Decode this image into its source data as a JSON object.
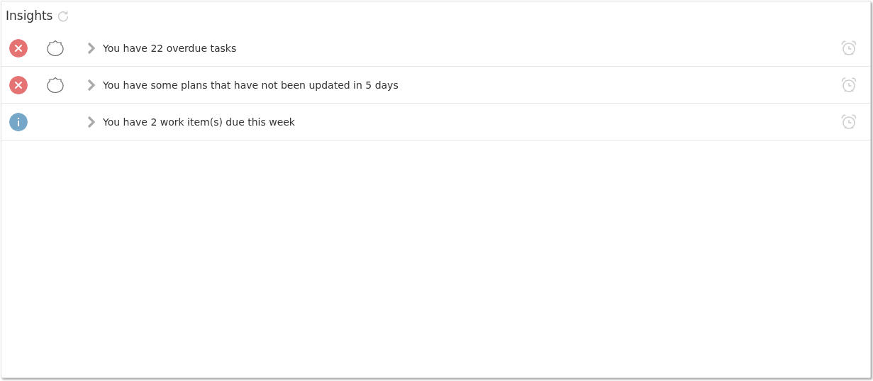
{
  "panel": {
    "title": "Insights"
  },
  "insights": [
    {
      "kind": "error",
      "shield": true,
      "text": "You have 22 overdue tasks"
    },
    {
      "kind": "error",
      "shield": true,
      "text": "You have some plans that have not been updated in 5 days"
    },
    {
      "kind": "info",
      "shield": false,
      "text": "You have 2 work item(s) due this week"
    }
  ]
}
